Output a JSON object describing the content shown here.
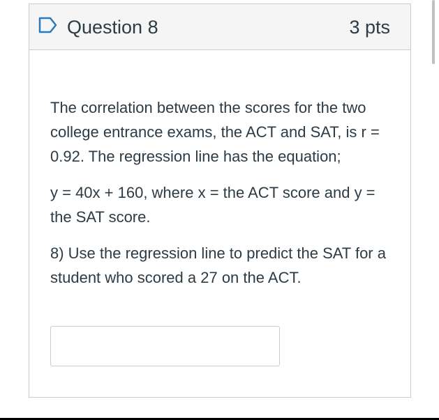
{
  "question": {
    "title": "Question 8",
    "points": "3 pts",
    "flag_icon": "flag-outline-icon",
    "body": {
      "paragraph1": "The correlation between the scores for the two college entrance exams, the ACT  and SAT, is r = 0.92.  The regression line has the equation;",
      "paragraph2": "y = 40x + 160, where x = the ACT score and y = the SAT score.",
      "paragraph3": "8)  Use the regression line to predict the SAT for a student who scored a 27 on the ACT."
    },
    "answer": {
      "value": "",
      "placeholder": ""
    }
  },
  "colors": {
    "header_background": "#f5f5f5",
    "border": "#c7cdd1",
    "text": "#2d3b45",
    "flag_accent": "#2b7abc"
  }
}
